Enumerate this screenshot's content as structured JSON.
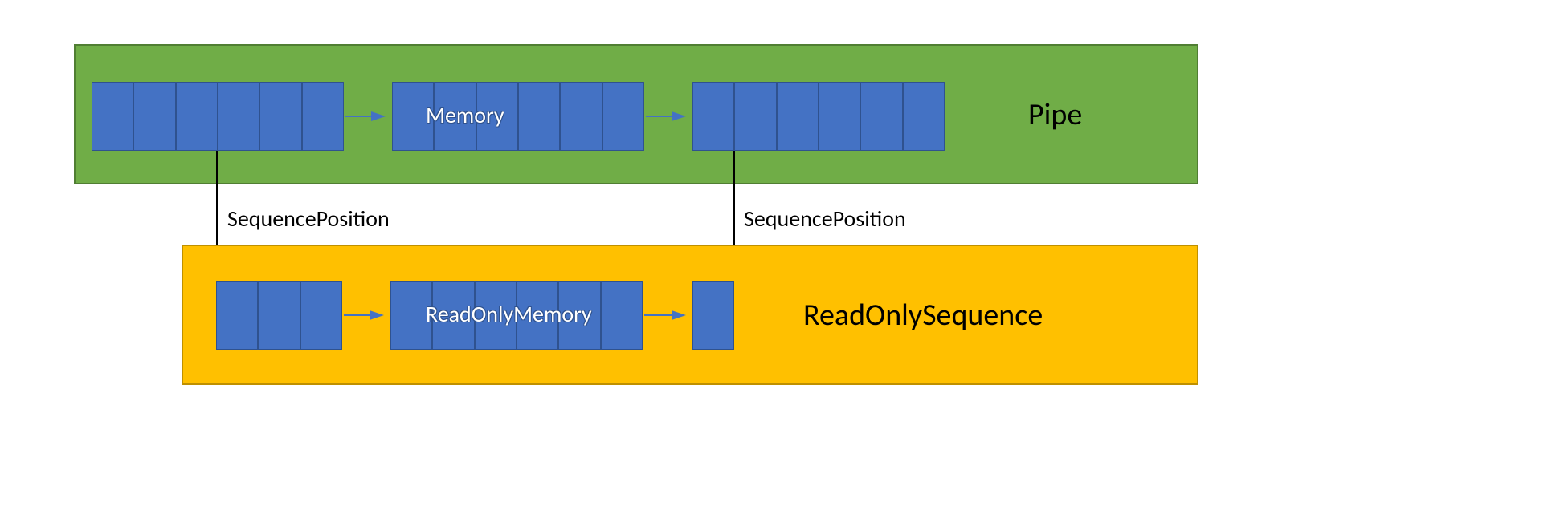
{
  "colors": {
    "pipe_bg": "#70ad47",
    "sequence_bg": "#ffc000",
    "block_fill": "#4472c4",
    "block_border": "#2f528f",
    "arrow": "#4472c4"
  },
  "pipe": {
    "label": "Pipe",
    "memory_label": "Memory",
    "block_cells": [
      6,
      6,
      6
    ]
  },
  "sequence": {
    "label": "ReadOnlySequence",
    "memory_label": "ReadOnlyMemory",
    "block_cells": [
      3,
      6,
      1
    ]
  },
  "position_labels": {
    "left": "SequencePosition",
    "right": "SequencePosition"
  }
}
